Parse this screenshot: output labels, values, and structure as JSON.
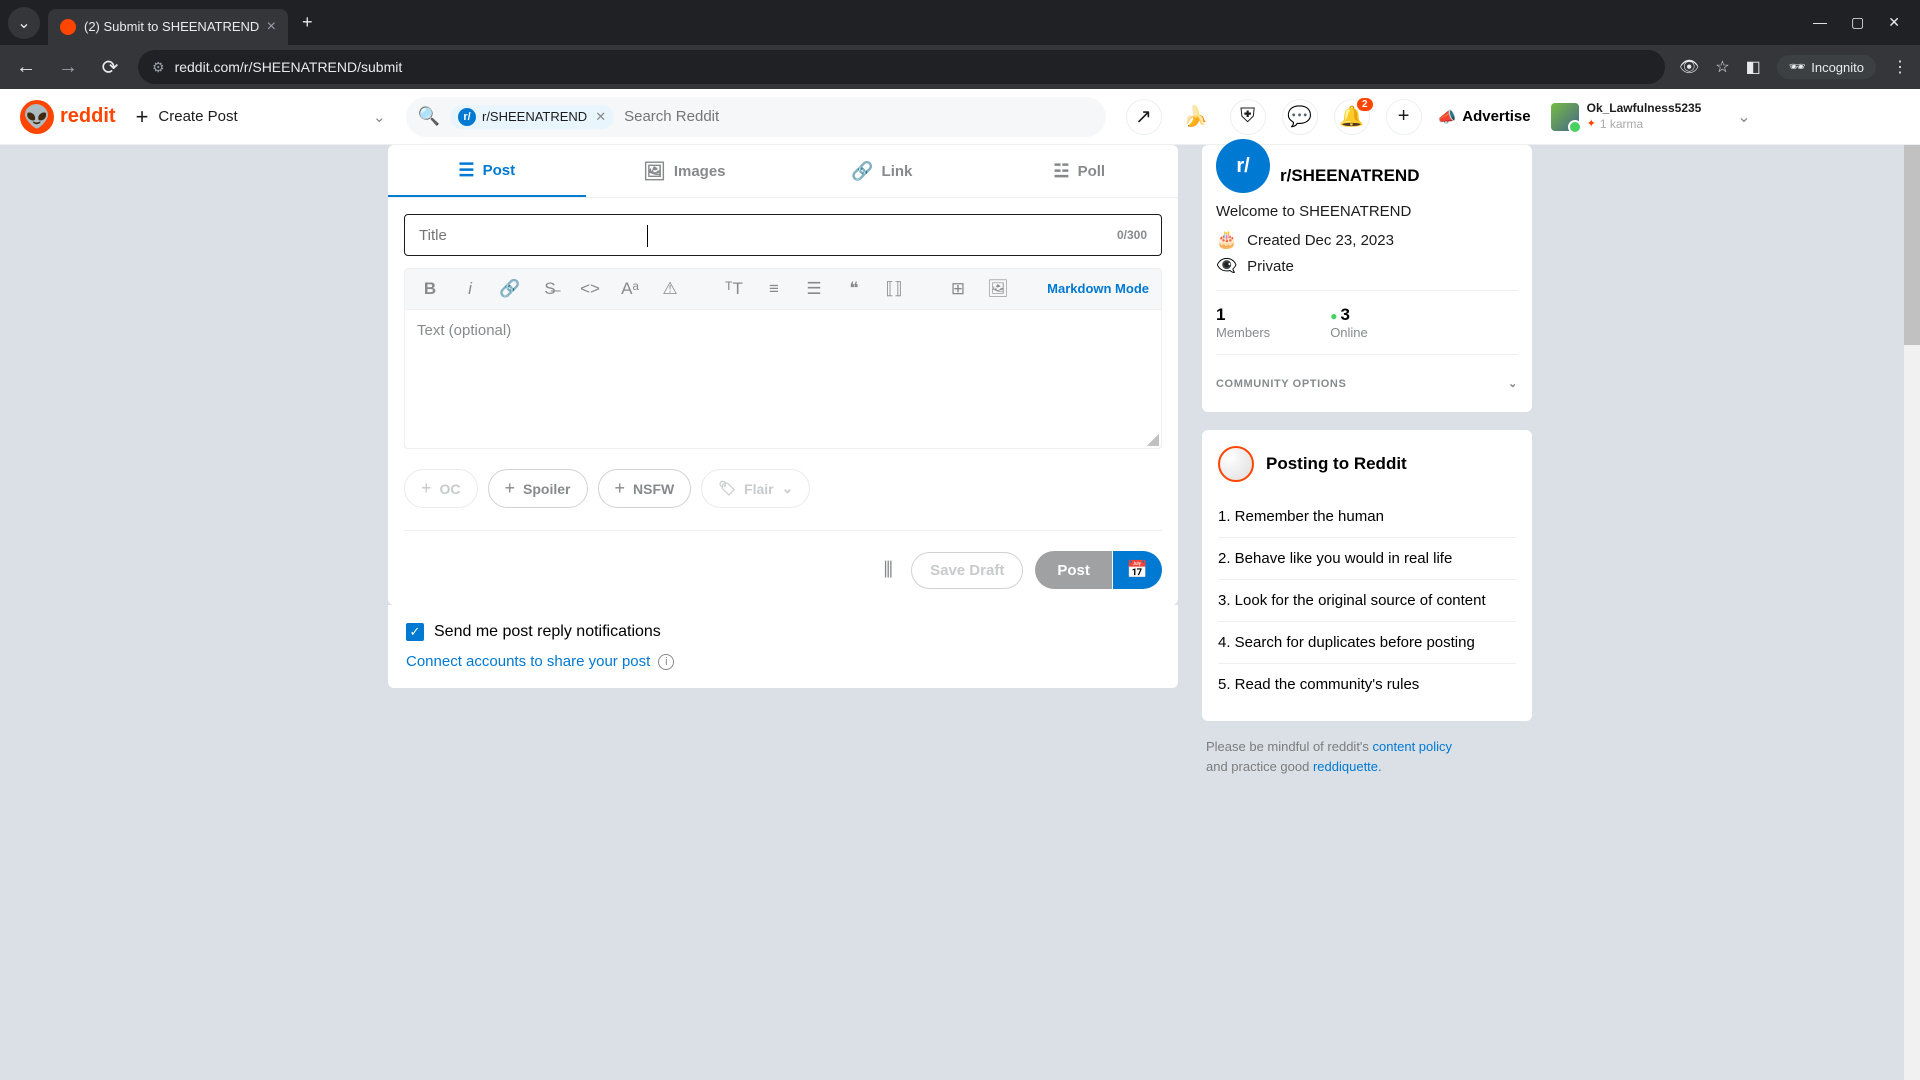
{
  "browser": {
    "tab_title": "(2) Submit to SHEENATREND",
    "url": "reddit.com/r/SHEENATREND/submit",
    "incognito_label": "Incognito"
  },
  "header": {
    "logo_text": "reddit",
    "create_post": "Create Post",
    "search_chip": "r/SHEENATREND",
    "search_placeholder": "Search Reddit",
    "notification_count": "2",
    "advertise": "Advertise",
    "username": "Ok_Lawfulness5235",
    "karma": "1 karma"
  },
  "post_form": {
    "tabs": {
      "post": "Post",
      "images": "Images",
      "link": "Link",
      "poll": "Poll"
    },
    "title_placeholder": "Title",
    "title_counter": "0/300",
    "markdown": "Markdown Mode",
    "body_placeholder": "Text (optional)",
    "tags": {
      "oc": "OC",
      "spoiler": "Spoiler",
      "nsfw": "NSFW",
      "flair": "Flair"
    },
    "save_draft": "Save Draft",
    "post": "Post",
    "notify_label": "Send me post reply notifications",
    "connect_label": "Connect accounts to share your post"
  },
  "community": {
    "name": "r/SHEENATREND",
    "avatar_text": "r/",
    "welcome": "Welcome to SHEENATREND",
    "created": "Created Dec 23, 2023",
    "privacy": "Private",
    "members_count": "1",
    "members_label": "Members",
    "online_count": "3",
    "online_label": "Online",
    "options_label": "COMMUNITY OPTIONS"
  },
  "rules": {
    "title": "Posting to Reddit",
    "items": [
      "1. Remember the human",
      "2. Behave like you would in real life",
      "3. Look for the original source of content",
      "4. Search for duplicates before posting",
      "5. Read the community's rules"
    ]
  },
  "footer": {
    "prefix": "Please be mindful of reddit's ",
    "content_policy": "content policy",
    "mid": " and practice good ",
    "reddiquette": "reddiquette."
  }
}
